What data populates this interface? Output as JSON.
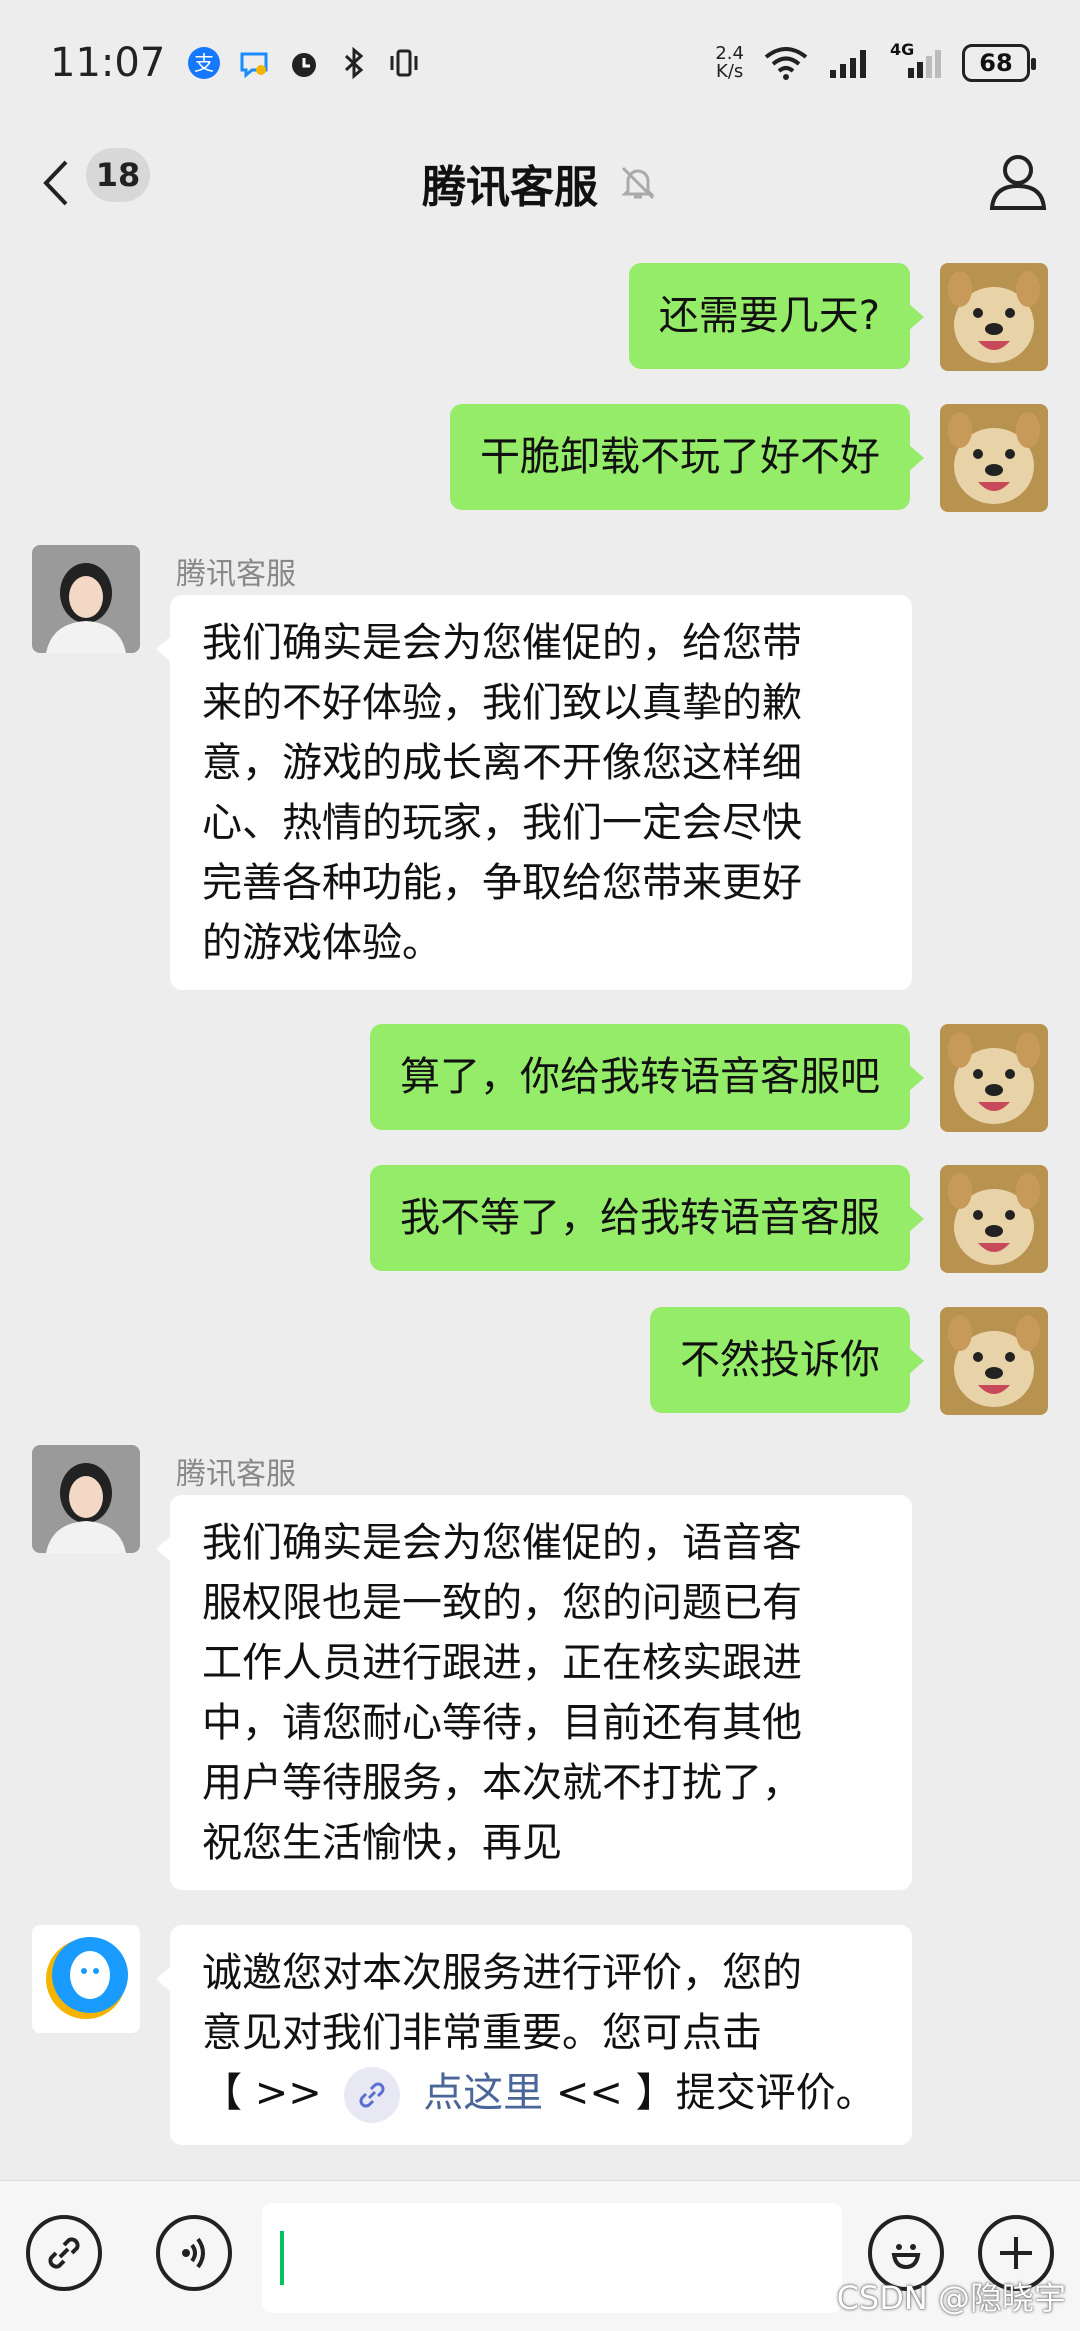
{
  "status_bar": {
    "time": "11:07",
    "speed_value": "2.4",
    "speed_unit": "K/s",
    "network": "4G",
    "battery": "68"
  },
  "nav": {
    "unread_count": "18",
    "title": "腾讯客服"
  },
  "messages": [
    {
      "side": "out",
      "text": "还需要几天?"
    },
    {
      "side": "out",
      "text": "干脆卸载不玩了好不好"
    },
    {
      "side": "in",
      "sender": "腾讯客服",
      "lines": [
        "我们确实是会为您催促的，给您带",
        "来的不好体验，我们致以真挚的歉",
        "意，游戏的成长离不开像您这样细",
        "心、热情的玩家，我们一定会尽快",
        "完善各种功能，争取给您带来更好",
        "的游戏体验。"
      ]
    },
    {
      "side": "out",
      "text": "算了，你给我转语音客服吧"
    },
    {
      "side": "out",
      "text": "我不等了，给我转语音客服"
    },
    {
      "side": "out",
      "text": "不然投诉你"
    },
    {
      "side": "in",
      "sender": "腾讯客服",
      "lines": [
        "我们确实是会为您催促的，语音客",
        "服权限也是一致的，您的问题已有",
        "工作人员进行跟进，正在核实跟进",
        "中，请您耐心等待，目前还有其他",
        "用户等待服务，本次就不打扰了，",
        "祝您生活愉快，再见"
      ]
    },
    {
      "side": "in",
      "lines": [
        "诚邀您对本次服务进行评价，您的",
        "意见对我们非常重要。您可点击"
      ],
      "link_prefix": "【 >>",
      "link_text": "点这里",
      "link_suffix": "<< 】提交评价。"
    }
  ],
  "input": {
    "value": ""
  },
  "watermark": "CSDN @隐晓宇",
  "colors": {
    "outgoing_bubble": "#95ec69",
    "incoming_bubble": "#ffffff",
    "background": "#ededed",
    "link": "#4a6699",
    "caret": "#07c160"
  }
}
